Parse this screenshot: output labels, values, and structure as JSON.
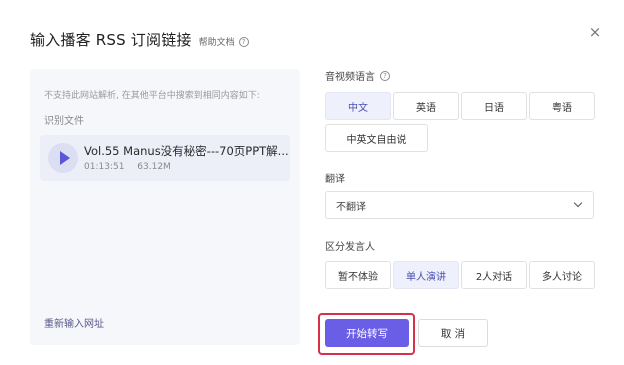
{
  "dialog": {
    "title": "输入播客 RSS 订阅链接",
    "help_label": "帮助文档",
    "help_icon": "question-circle-icon",
    "close_label": "×"
  },
  "left": {
    "unsupported_text": "不支持此网站解析, 在其他平台中搜索到相同内容如下:",
    "recognized_label": "识别文件",
    "file": {
      "title": "Vol.55 Manus没有秘密---70页PPT解...",
      "duration": "01:13:51",
      "size": "63.12M"
    },
    "reenter_label": "重新输入网址"
  },
  "language": {
    "label": "音视频语言",
    "options": [
      "中文",
      "英语",
      "日语",
      "粤语",
      "中英文自由说"
    ],
    "selected": "中文"
  },
  "translate": {
    "label": "翻译",
    "value": "不翻译"
  },
  "speaker": {
    "label": "区分发言人",
    "options": [
      "暂不体验",
      "单人演讲",
      "2人对话",
      "多人讨论"
    ],
    "selected": "单人演讲"
  },
  "actions": {
    "start_label": "开始转写",
    "cancel_label": "取 消"
  },
  "colors": {
    "accent": "#6a5ee6",
    "highlight_border": "#d9304a",
    "selected_bg": "#eef0fb"
  }
}
